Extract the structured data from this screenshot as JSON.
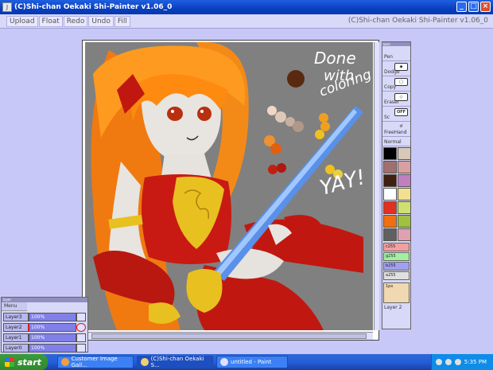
{
  "window": {
    "title": "(C)Shi-chan Oekaki Shi-Painter v1.06_0",
    "icon_text": "J",
    "minimize": "_",
    "maximize": "□",
    "close": "×"
  },
  "toolbar": {
    "buttons": [
      "Upload",
      "Float",
      "Redo",
      "Undo",
      "Fill"
    ],
    "right_title": "(C)Shi-chan Oekaki Shi-Painter v1.06_0"
  },
  "canvas": {
    "text_done": "Done",
    "text_with": "with",
    "text_coloring": "coloring",
    "text_yay": "YAY!"
  },
  "tools": {
    "header": "tools",
    "items": [
      {
        "label": "Pen",
        "icon": ""
      },
      {
        "label": "Dodge",
        "icon": "◆"
      },
      {
        "label": "Copy",
        "icon": "□"
      },
      {
        "label": "Eraser",
        "icon": "◇"
      },
      {
        "label": "Sc",
        "icon": "OFF"
      },
      {
        "label": "FreeHand",
        "icon": "↺"
      },
      {
        "label": "Normal",
        "icon": ""
      }
    ],
    "swatches": [
      "#000000",
      "#d8c8b8",
      "#a07070",
      "#d8a0a0",
      "#402010",
      "#c080c0",
      "#ffffff",
      "#f0e090",
      "#e03020",
      "#d0e070",
      "#f07010",
      "#a0c040",
      "#606060",
      "#e0a0b0"
    ],
    "sliders": [
      {
        "label": "c255",
        "color": "#f0a0a0"
      },
      {
        "label": "g255",
        "color": "#a0f0a0"
      },
      {
        "label": "b255",
        "color": "#a0a0f0"
      },
      {
        "label": "a255",
        "color": "#e0e0e0"
      }
    ],
    "size": "1px",
    "layer_label": "Layer 2"
  },
  "layers": {
    "header": "layer",
    "menu": "Menu",
    "rows": [
      {
        "name": "Layer3",
        "opacity": "100%"
      },
      {
        "name": "Layer2",
        "opacity": "100%"
      },
      {
        "name": "Layer1",
        "opacity": "100%"
      },
      {
        "name": "Layer0",
        "opacity": "100%"
      }
    ]
  },
  "taskbar": {
    "start": "start",
    "tasks": [
      {
        "label": "Customer Image Gall..."
      },
      {
        "label": "(C)Shi-chan Oekaki S..."
      },
      {
        "label": "untitled - Paint"
      }
    ],
    "clock": "5:35 PM"
  }
}
